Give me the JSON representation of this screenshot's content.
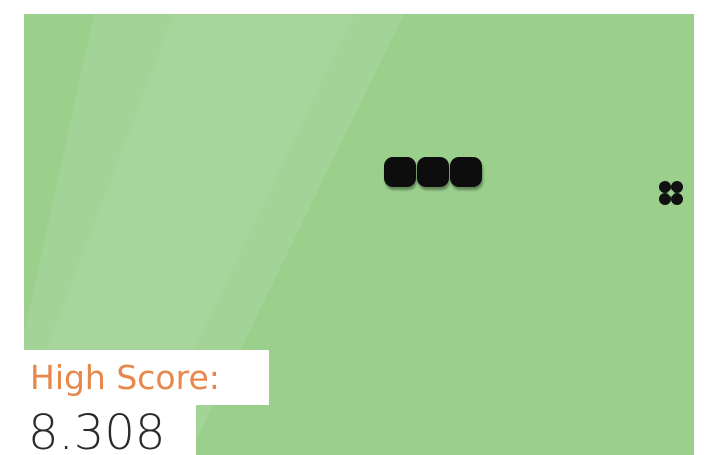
{
  "game": {
    "board_color": "#9acf8c",
    "snake_color": "#0d0d0d",
    "snake_segments": 3,
    "food_icon": "flower-icon"
  },
  "hud": {
    "high_score_label": "High Score:",
    "high_score_value": "8.308",
    "label_color": "#e8874a",
    "value_color": "#2a2a2a"
  }
}
